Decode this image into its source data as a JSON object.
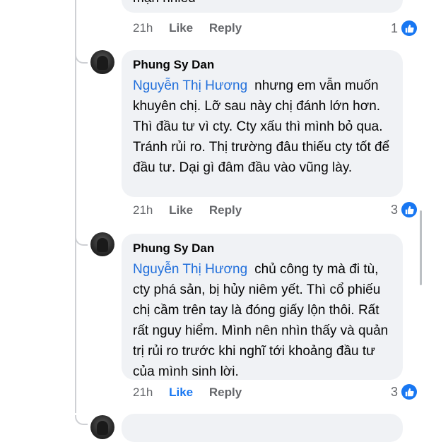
{
  "top_comment": {
    "partial_text": "mặn nhiều",
    "time": "21h",
    "like_label": "Like",
    "reply_label": "Reply",
    "reaction_count": "1",
    "reaction_icon": "thumbs-up-icon"
  },
  "comments": [
    {
      "author": "Phung Sy Dan",
      "mention": "Nguyễn Thị Hương",
      "text": "nhưng em vẫn muốn khuyên chị. Lỡ sau này chị đánh lớn hơn. Thì đầu tư vì cty. Cty xấu thì mình bỏ qua. Tránh rủi ro. Thị trường đâu thiếu cty tốt để đầu tư. Dại gì đâm đầu vào vũng lày.",
      "time": "21h",
      "like_label": "Like",
      "reply_label": "Reply",
      "reaction_count": "3",
      "liked": false
    },
    {
      "author": "Phung Sy Dan",
      "mention": "Nguyễn Thị Hương",
      "text": "chủ công ty mà đi tù, cty phá sản, bị hủy niêm yết. Thì cổ phiếu chị cầm trên tay là đóng giấy lộn thôi. Rất rất nguy hiểm. Mình nên nhìn thấy và quản trị rủi ro trước khi nghĩ tới khoảng đầu tư của mình sinh lời.",
      "time": "21h",
      "like_label": "Like",
      "reply_label": "Reply",
      "reaction_count": "3",
      "liked": true
    }
  ],
  "colors": {
    "mention": "#216fdb",
    "like_active": "#1877f2",
    "bubble": "#f0f2f5",
    "meta": "#65676b"
  }
}
